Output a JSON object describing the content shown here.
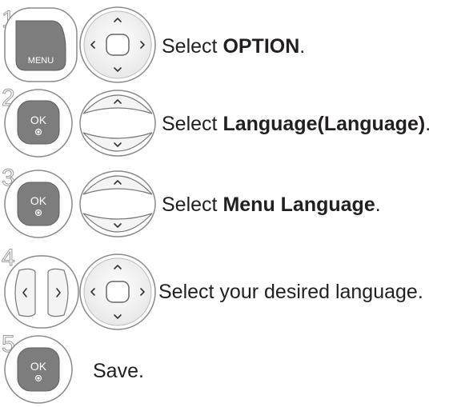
{
  "steps": [
    {
      "number": "1",
      "button_label": "MENU",
      "prefix": "Select ",
      "bold": "OPTION",
      "suffix": "."
    },
    {
      "number": "2",
      "button_label": "OK",
      "prefix": "Select ",
      "bold": "Language(Language)",
      "suffix": "."
    },
    {
      "number": "3",
      "button_label": "OK",
      "prefix": "Select ",
      "bold": "Menu Language",
      "suffix": "."
    },
    {
      "number": "4",
      "prefix": "Select your desired language.",
      "bold": "",
      "suffix": ""
    },
    {
      "number": "5",
      "button_label": "OK",
      "prefix": "Save.",
      "bold": "",
      "suffix": ""
    }
  ],
  "icons": [
    "menu-button-icon",
    "ok-button-icon",
    "navigation-pad-icon",
    "up-down-rocker-icon",
    "left-right-buttons-icon"
  ]
}
